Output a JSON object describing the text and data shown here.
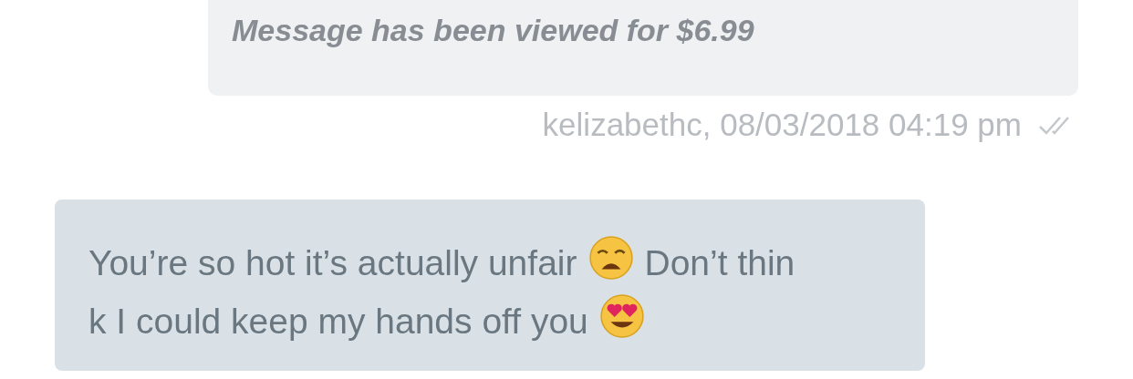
{
  "messages": [
    {
      "kind": "paid_notice",
      "text": "Message has been viewed for $6.99",
      "meta": "kelizabethc, 08/03/2018 04:19 pm",
      "read": true
    },
    {
      "kind": "incoming",
      "lines": [
        [
          {
            "kind": "text",
            "text": "You’re so hot it’s actually unfair"
          },
          {
            "kind": "weary_face"
          },
          {
            "kind": "text",
            "text": "Don’t thin"
          }
        ],
        [
          {
            "kind": "text",
            "text": "k I could keep my hands off you"
          },
          {
            "kind": "heart_eyes_face"
          }
        ]
      ]
    }
  ]
}
